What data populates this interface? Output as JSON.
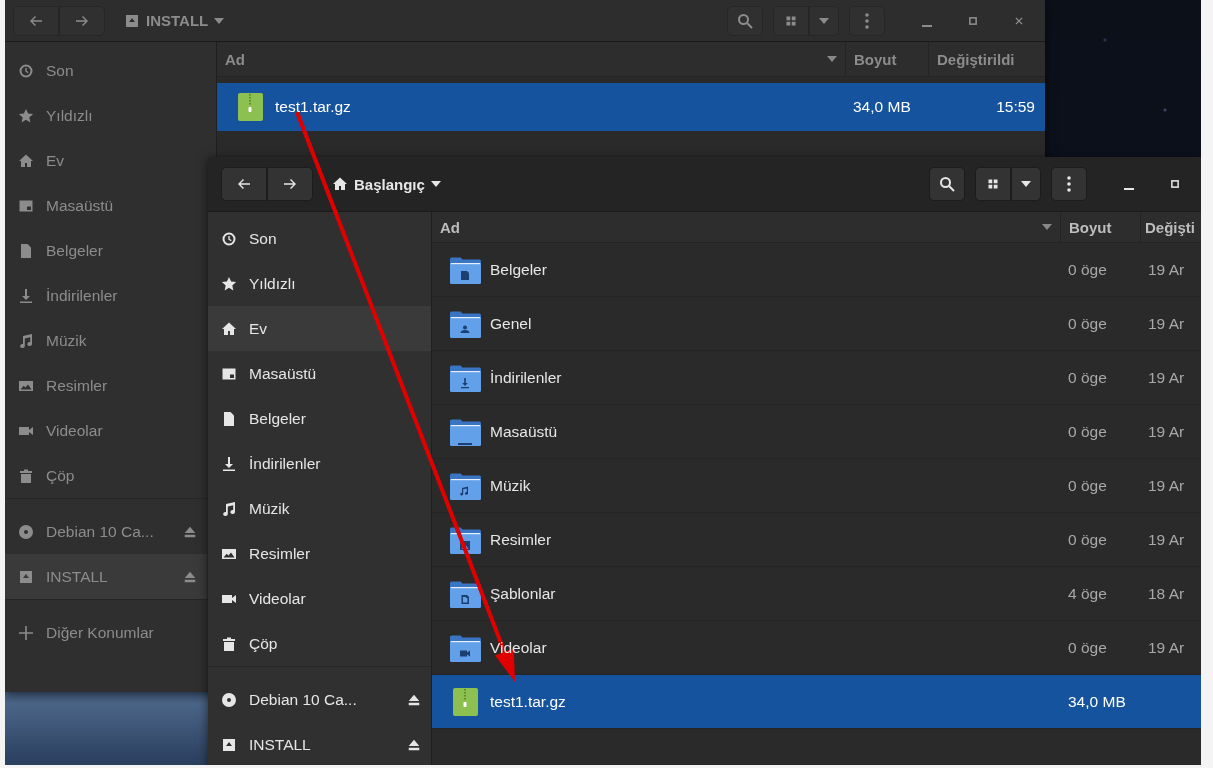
{
  "back_window": {
    "active": false,
    "location": "INSTALL",
    "sidebar_sections": [
      {
        "items": [
          {
            "kind": "recent",
            "label": "Son",
            "selected": false,
            "eject": false
          },
          {
            "kind": "starred",
            "label": "Yıldızlı",
            "selected": false,
            "eject": false
          },
          {
            "kind": "home",
            "label": "Ev",
            "selected": false,
            "eject": false
          },
          {
            "kind": "desktop",
            "label": "Masaüstü",
            "selected": false,
            "eject": false
          },
          {
            "kind": "documents",
            "label": "Belgeler",
            "selected": false,
            "eject": false
          },
          {
            "kind": "downloads",
            "label": "İndirilenler",
            "selected": false,
            "eject": false
          },
          {
            "kind": "music",
            "label": "Müzik",
            "selected": false,
            "eject": false
          },
          {
            "kind": "pictures",
            "label": "Resimler",
            "selected": false,
            "eject": false
          },
          {
            "kind": "videos",
            "label": "Videolar",
            "selected": false,
            "eject": false
          },
          {
            "kind": "trash",
            "label": "Çöp",
            "selected": false,
            "eject": false
          }
        ]
      },
      {
        "items": [
          {
            "kind": "disc",
            "label": "Debian 10 Ca...",
            "selected": false,
            "eject": true
          },
          {
            "kind": "drive",
            "label": "INSTALL",
            "selected": true,
            "eject": true
          }
        ]
      },
      {
        "items": [
          {
            "kind": "add",
            "label": "Diğer Konumlar",
            "selected": false,
            "eject": false
          }
        ]
      }
    ],
    "columns": [
      "Ad",
      "Boyut",
      "Değiştirildi"
    ],
    "rows": [
      {
        "kind": "archive",
        "name": "test1.tar.gz",
        "size": "34,0 MB",
        "modified": "15:59",
        "selected": true
      }
    ]
  },
  "front_window": {
    "active": true,
    "location": "Başlangıç",
    "sidebar_sections": [
      {
        "items": [
          {
            "kind": "recent",
            "label": "Son",
            "selected": false,
            "eject": false
          },
          {
            "kind": "starred",
            "label": "Yıldızlı",
            "selected": false,
            "eject": false
          },
          {
            "kind": "home",
            "label": "Ev",
            "selected": true,
            "eject": false
          },
          {
            "kind": "desktop",
            "label": "Masaüstü",
            "selected": false,
            "eject": false
          },
          {
            "kind": "documents",
            "label": "Belgeler",
            "selected": false,
            "eject": false
          },
          {
            "kind": "downloads",
            "label": "İndirilenler",
            "selected": false,
            "eject": false
          },
          {
            "kind": "music",
            "label": "Müzik",
            "selected": false,
            "eject": false
          },
          {
            "kind": "pictures",
            "label": "Resimler",
            "selected": false,
            "eject": false
          },
          {
            "kind": "videos",
            "label": "Videolar",
            "selected": false,
            "eject": false
          },
          {
            "kind": "trash",
            "label": "Çöp",
            "selected": false,
            "eject": false
          }
        ]
      },
      {
        "items": [
          {
            "kind": "disc",
            "label": "Debian 10 Ca...",
            "selected": false,
            "eject": true
          },
          {
            "kind": "drive",
            "label": "INSTALL",
            "selected": false,
            "eject": true
          }
        ]
      }
    ],
    "columns": [
      "Ad",
      "Boyut",
      "Değişti"
    ],
    "rows": [
      {
        "kind": "documents",
        "name": "Belgeler",
        "size": "0 öge",
        "modified": "19 Ar",
        "selected": false
      },
      {
        "kind": "public",
        "name": "Genel",
        "size": "0 öge",
        "modified": "19 Ar",
        "selected": false
      },
      {
        "kind": "downloads",
        "name": "İndirilenler",
        "size": "0 öge",
        "modified": "19 Ar",
        "selected": false
      },
      {
        "kind": "desktop",
        "name": "Masaüstü",
        "size": "0 öge",
        "modified": "19 Ar",
        "selected": false
      },
      {
        "kind": "music",
        "name": "Müzik",
        "size": "0 öge",
        "modified": "19 Ar",
        "selected": false
      },
      {
        "kind": "pictures",
        "name": "Resimler",
        "size": "0 öge",
        "modified": "19 Ar",
        "selected": false
      },
      {
        "kind": "templates",
        "name": "Şablonlar",
        "size": "4 öge",
        "modified": "18 Ar",
        "selected": false
      },
      {
        "kind": "videos",
        "name": "Videolar",
        "size": "0 öge",
        "modified": "19 Ar",
        "selected": false
      },
      {
        "kind": "archive",
        "name": "test1.tar.gz",
        "size": "34,0 MB",
        "selected": true
      }
    ]
  }
}
